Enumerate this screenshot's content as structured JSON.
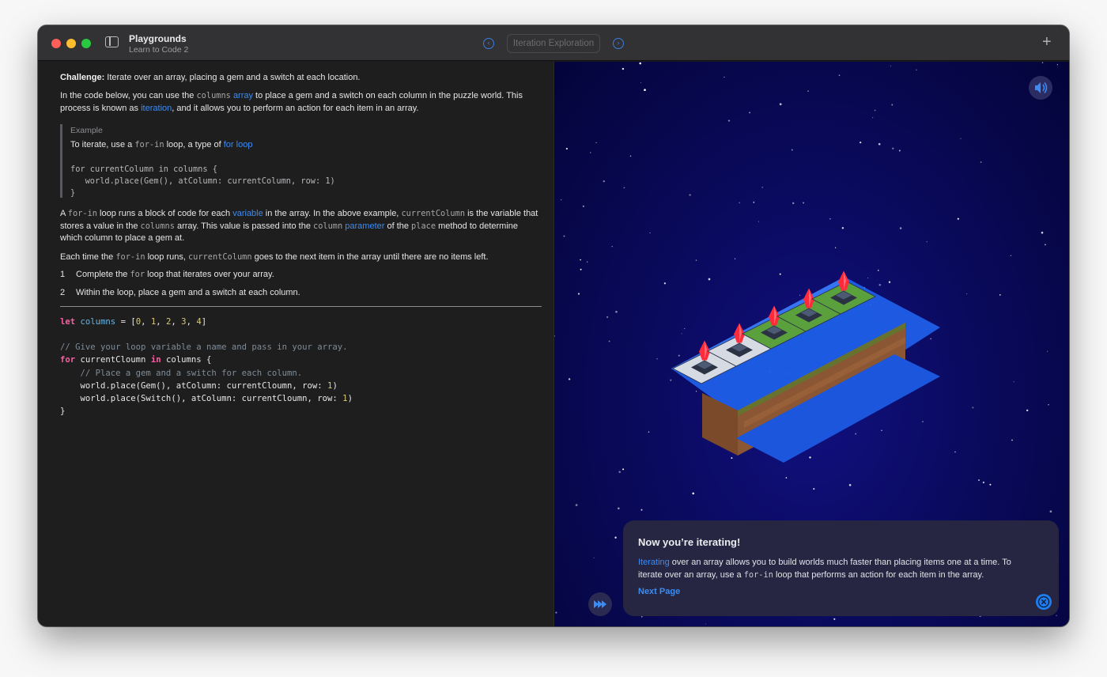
{
  "titlebar": {
    "app_title": "Playgrounds",
    "app_subtitle": "Learn to Code 2",
    "page_title": "Iteration Exploration",
    "prev_glyph": "‹",
    "next_glyph": "›",
    "add_glyph": "+"
  },
  "instructions": {
    "challenge_label": "Challenge:",
    "challenge_text": " Iterate over an array, placing a gem and a switch at each location.",
    "p1_a": "In the code below, you can use the ",
    "p1_code": "columns",
    "p1_link1": "array",
    "p1_b": " to place a gem and a switch on each column in the puzzle world. This",
    "p1_c": "process is known as ",
    "p1_link2": "iteration",
    "p1_d": ", and it allows you to perform an action for each item in an array.",
    "example": {
      "title": "Example",
      "line_a": "To iterate, use a ",
      "line_code": "for-in",
      "line_b": " loop, a type of ",
      "line_link": "for loop",
      "code_1": "for currentColumn in columns {",
      "code_2": "   world.place(Gem(), atColumn: currentColumn, row: 1)",
      "code_3": "}"
    },
    "p2_a": "A ",
    "p2_code1": "for-in",
    "p2_b": " loop runs a block of code for each ",
    "p2_link1": "variable",
    "p2_c": " in the array. In the above example, ",
    "p2_code2": "currentColumn",
    "p2_d": " is the variable that",
    "p2_e": "stores a value in the ",
    "p2_code3": "columns",
    "p2_f": " array. This value is passed into the ",
    "p2_code4": "column",
    "p2_link2": "parameter",
    "p2_g": " of the ",
    "p2_code5": "place",
    "p2_h": " method to determine",
    "p2_i": "which column to place a gem at.",
    "p3_a": "Each time the ",
    "p3_code1": "for-in",
    "p3_b": " loop runs, ",
    "p3_code2": "currentColumn",
    "p3_c": " goes to the next item in the array until there are no items left.",
    "steps": [
      {
        "num": "1",
        "a": "Complete the ",
        "code": "for",
        "b": " loop that iterates over your array."
      },
      {
        "num": "2",
        "a": "Within the loop, place a gem and a switch at each column.",
        "code": "",
        "b": ""
      }
    ]
  },
  "editor": {
    "l1_kw": "let",
    "l1_var": "columns",
    "l1_a": " = [",
    "nums": [
      "0",
      "1",
      "2",
      "3",
      "4"
    ],
    "sep": ", ",
    "l1_end": "]",
    "l2_comment": "// Give your loop variable a name and pass in your array.",
    "l3_kw1": "for",
    "l3_a": " currentCloumn ",
    "l3_kw2": "in",
    "l3_b": " columns {",
    "l4_comment": "    // Place a gem and a switch for each column.",
    "l5_a": "    world.place(Gem(), atColumn: currentCloumn, row: ",
    "l5_num": "1",
    "l5_b": ")",
    "l6_a": "    world.place(Switch(), atColumn: currentCloumn, row: ",
    "l6_num": "1",
    "l6_b": ")",
    "l7": "}"
  },
  "card": {
    "title": "Now you’re iterating!",
    "link_word": "Iterating",
    "text_a": " over an array allows you to build worlds much faster than placing items one at a time. To iterate over an array, use a ",
    "text_code": "for-in",
    "text_b": " loop that performs an action for each item in the array.",
    "next_label": "Next Page"
  },
  "icons": {
    "sound": "speaker-wave-icon",
    "fast_forward": "fast-forward-icon",
    "close": "close-icon",
    "sidebar": "sidebar-toggle-icon"
  },
  "colors": {
    "accent": "#3b8cf5",
    "keyword": "#fc5fa3",
    "variable": "#67b7e8",
    "number": "#d9c97c",
    "comment": "#7f8c98",
    "gem": "#ff2a3a",
    "switch_on": "#5aa03c",
    "water": "#1f5fe8"
  }
}
